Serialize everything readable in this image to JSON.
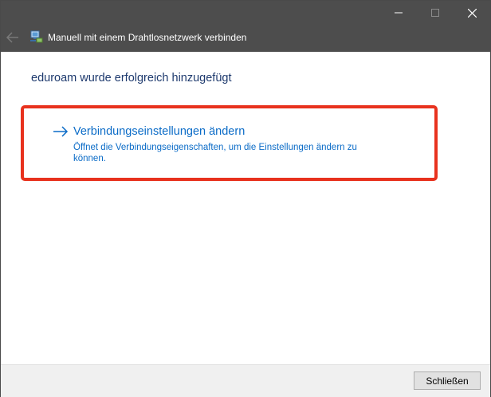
{
  "window": {
    "title": "Manuell mit einem Drahtlosnetzwerk verbinden",
    "controls": {
      "minimize": "minimize-icon",
      "maximize": "maximize-icon",
      "close": "close-icon"
    }
  },
  "content": {
    "heading": "eduroam wurde erfolgreich hinzugefügt",
    "action": {
      "title": "Verbindungseinstellungen ändern",
      "description": "Öffnet die Verbindungseigenschaften, um die Einstellungen ändern zu können."
    }
  },
  "footer": {
    "close_label": "Schließen"
  },
  "colors": {
    "titlebar": "#4d4d4d",
    "link": "#0a6bc7",
    "heading": "#1e3a6e",
    "highlight": "#e8321e",
    "footer": "#f0f0f0"
  }
}
